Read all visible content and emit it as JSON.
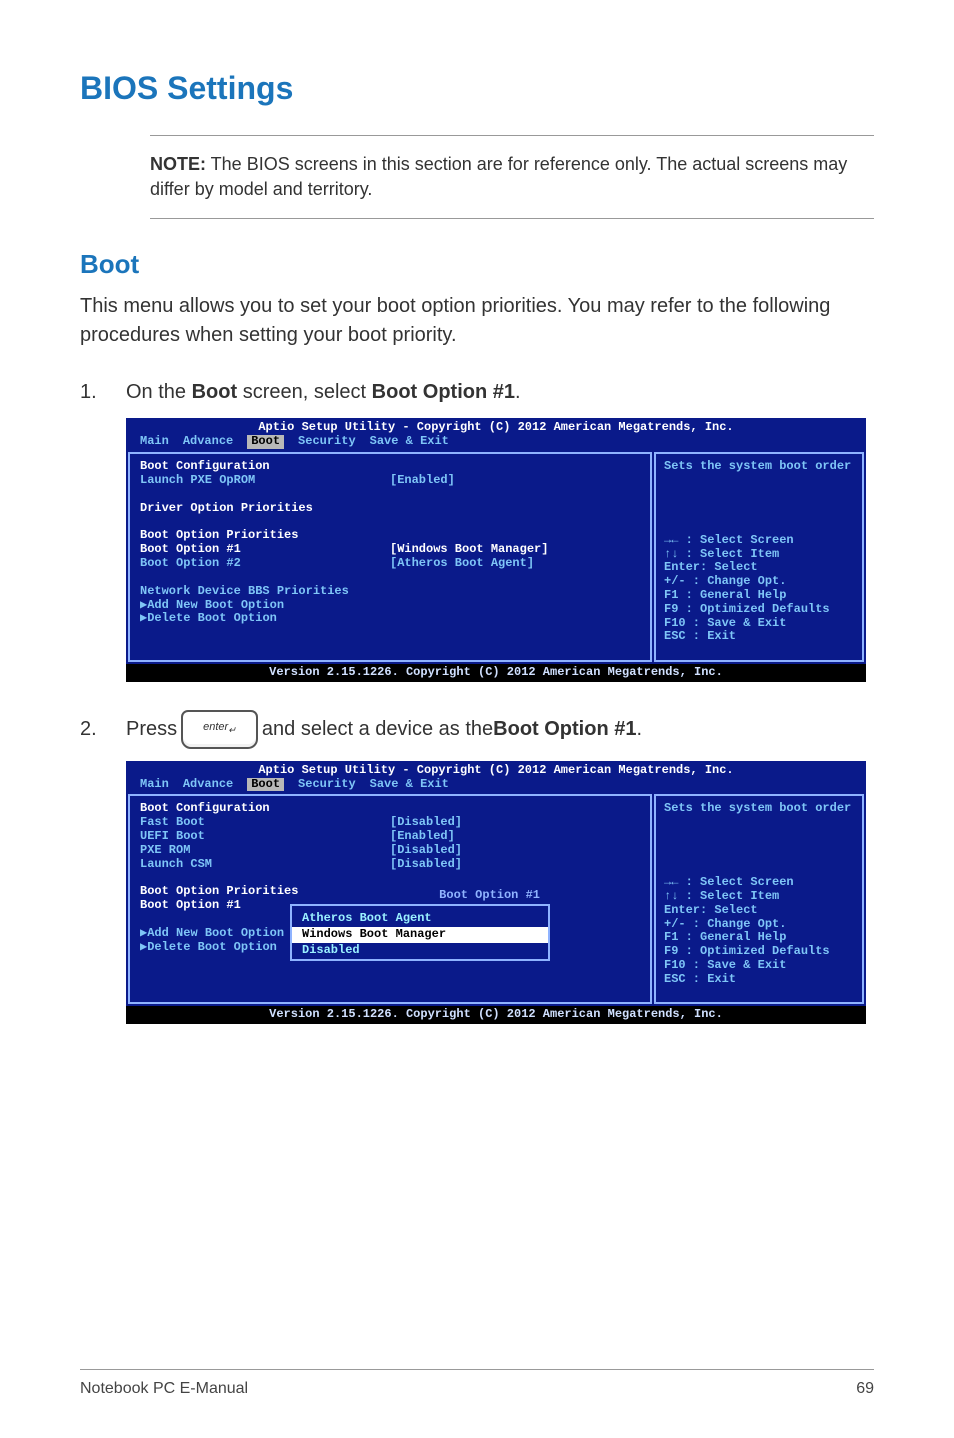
{
  "page": {
    "title": "BIOS Settings",
    "note_label": "NOTE:",
    "note_text": " The BIOS screens in this section are for reference only. The actual screens may differ by model and territory.",
    "boot_heading": "Boot",
    "boot_intro": "This menu allows you to set your boot option priorities. You may refer to the following procedures when setting your boot priority.",
    "step1_num": "1.",
    "step1_a": "On the ",
    "step1_b": "Boot",
    "step1_c": " screen, select ",
    "step1_d": "Boot Option #1",
    "step1_e": ".",
    "step2_num": "2.",
    "step2_a": "Press ",
    "step2_key": "enter",
    "step2_b": " and select a device as the ",
    "step2_c": "Boot Option #1",
    "step2_d": "."
  },
  "bios_common": {
    "title": "Aptio Setup Utility - Copyright (C) 2012 American Megatrends, Inc.",
    "footer": "Version 2.15.1226. Copyright (C) 2012 American Megatrends, Inc.",
    "tabs": {
      "main": "Main",
      "advance": "Advance",
      "boot": "Boot",
      "security": "Security",
      "save": "Save & Exit"
    },
    "help": {
      "desc": "Sets the system boot order",
      "l1": "→←  : Select Screen",
      "l2": "↑↓  : Select Item",
      "l3": "Enter: Select",
      "l4": "+/-  : Change Opt.",
      "l5": "F1   : General Help",
      "l6": "F9   : Optimized Defaults",
      "l7": "F10  : Save & Exit",
      "l8": "ESC  : Exit"
    }
  },
  "bios1": {
    "boot_config": "Boot Configuration",
    "launch_pxe": "Launch PXE OpROM",
    "launch_pxe_val": "[Enabled]",
    "driver_prio": "Driver Option Priorities",
    "boot_prio": "Boot Option Priorities",
    "opt1": "Boot Option #1",
    "opt1_val": "[Windows Boot Manager]",
    "opt2": "Boot Option #2",
    "opt2_val": "[Atheros Boot Agent]",
    "net_bbs": "Network Device BBS Priorities",
    "add_new": "Add New Boot Option",
    "delete": "Delete Boot Option"
  },
  "bios2": {
    "boot_config": "Boot Configuration",
    "fast_boot": "Fast Boot",
    "fast_boot_val": "[Disabled]",
    "uefi_boot": "UEFI Boot",
    "uefi_boot_val": "[Enabled]",
    "pxe_rom": "PXE ROM",
    "pxe_rom_val": "[Disabled]",
    "launch_csm": "Launch CSM",
    "launch_csm_val": "[Disabled]",
    "boot_prio": "Boot Option Priorities",
    "opt1": "Boot Option #1",
    "add_new": "Add New Boot Option",
    "delete": "Delete Boot Option",
    "popup_title": "Boot Option #1",
    "popup_items": [
      "Atheros Boot Agent",
      "Windows Boot Manager",
      "Disabled"
    ]
  },
  "footer": {
    "left": "Notebook PC E-Manual",
    "right": "69"
  }
}
